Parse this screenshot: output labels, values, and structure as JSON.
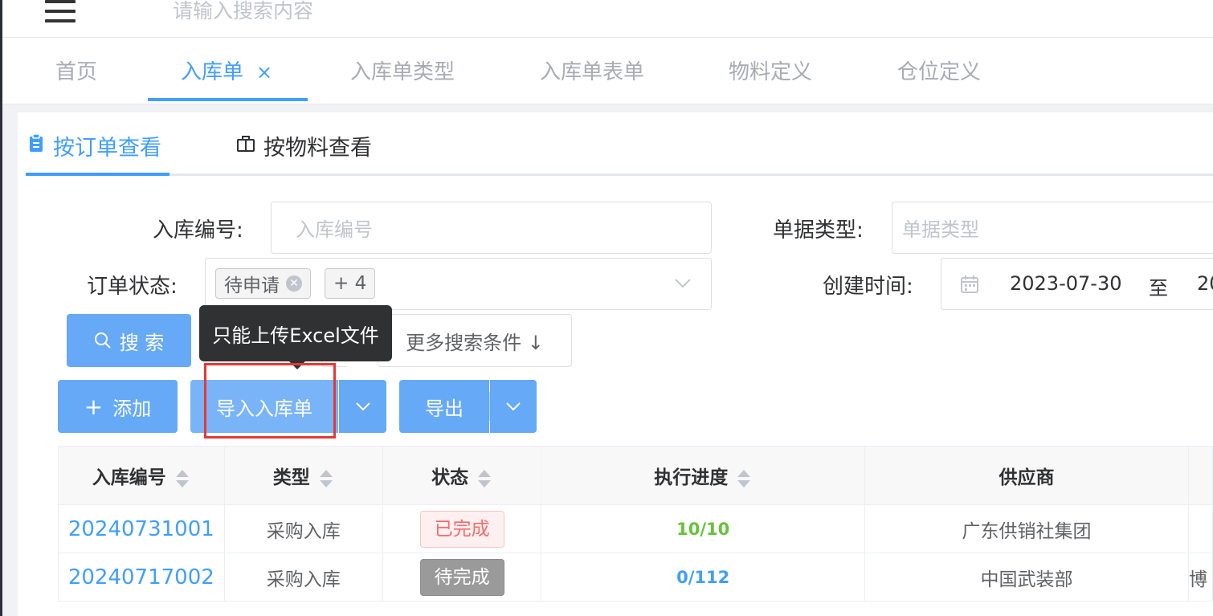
{
  "header": {
    "search_placeholder": "请输入搜索内容"
  },
  "tabs": [
    {
      "label": "首页",
      "active": false
    },
    {
      "label": "入库单",
      "active": true,
      "close": "×"
    },
    {
      "label": "入库单类型",
      "active": false
    },
    {
      "label": "入库单表单",
      "active": false
    },
    {
      "label": "物料定义",
      "active": false
    },
    {
      "label": "仓位定义",
      "active": false
    }
  ],
  "subtabs": [
    {
      "label": "按订单查看",
      "icon": "clipboard-icon",
      "active": true
    },
    {
      "label": "按物料查看",
      "icon": "package-icon",
      "active": false
    }
  ],
  "form": {
    "order_no_label": "入库编号:",
    "order_no_placeholder": "入库编号",
    "doc_type_label": "单据类型:",
    "doc_type_placeholder": "单据类型",
    "status_label": "订单状态:",
    "status_chip": "待申请",
    "status_more": "+ 4",
    "created_label": "创建时间:",
    "created_from": "2023-07-30",
    "created_to_sep": "至",
    "created_to_partial": "20"
  },
  "buttons": {
    "search": "搜 索",
    "more_search": "更多搜索条件 ↓",
    "add": "添加",
    "import": "导入入库单",
    "export": "导出"
  },
  "tooltip": "只能上传Excel文件",
  "table": {
    "columns": [
      "入库编号",
      "类型",
      "状态",
      "执行进度",
      "供应商"
    ],
    "rows": [
      {
        "no": "20240731001",
        "type": "采购入库",
        "status": "已完成",
        "progress": "10/10",
        "supplier": "广东供销社集团",
        "extra": ""
      },
      {
        "no": "20240717002",
        "type": "采购入库",
        "status": "待完成",
        "progress": "0/112",
        "supplier": "中国武装部",
        "extra": "博"
      }
    ]
  },
  "colors": {
    "accent": "#409eff",
    "button": "#66a9f7",
    "done": "#f56c6c",
    "highlight": "#e53935"
  }
}
